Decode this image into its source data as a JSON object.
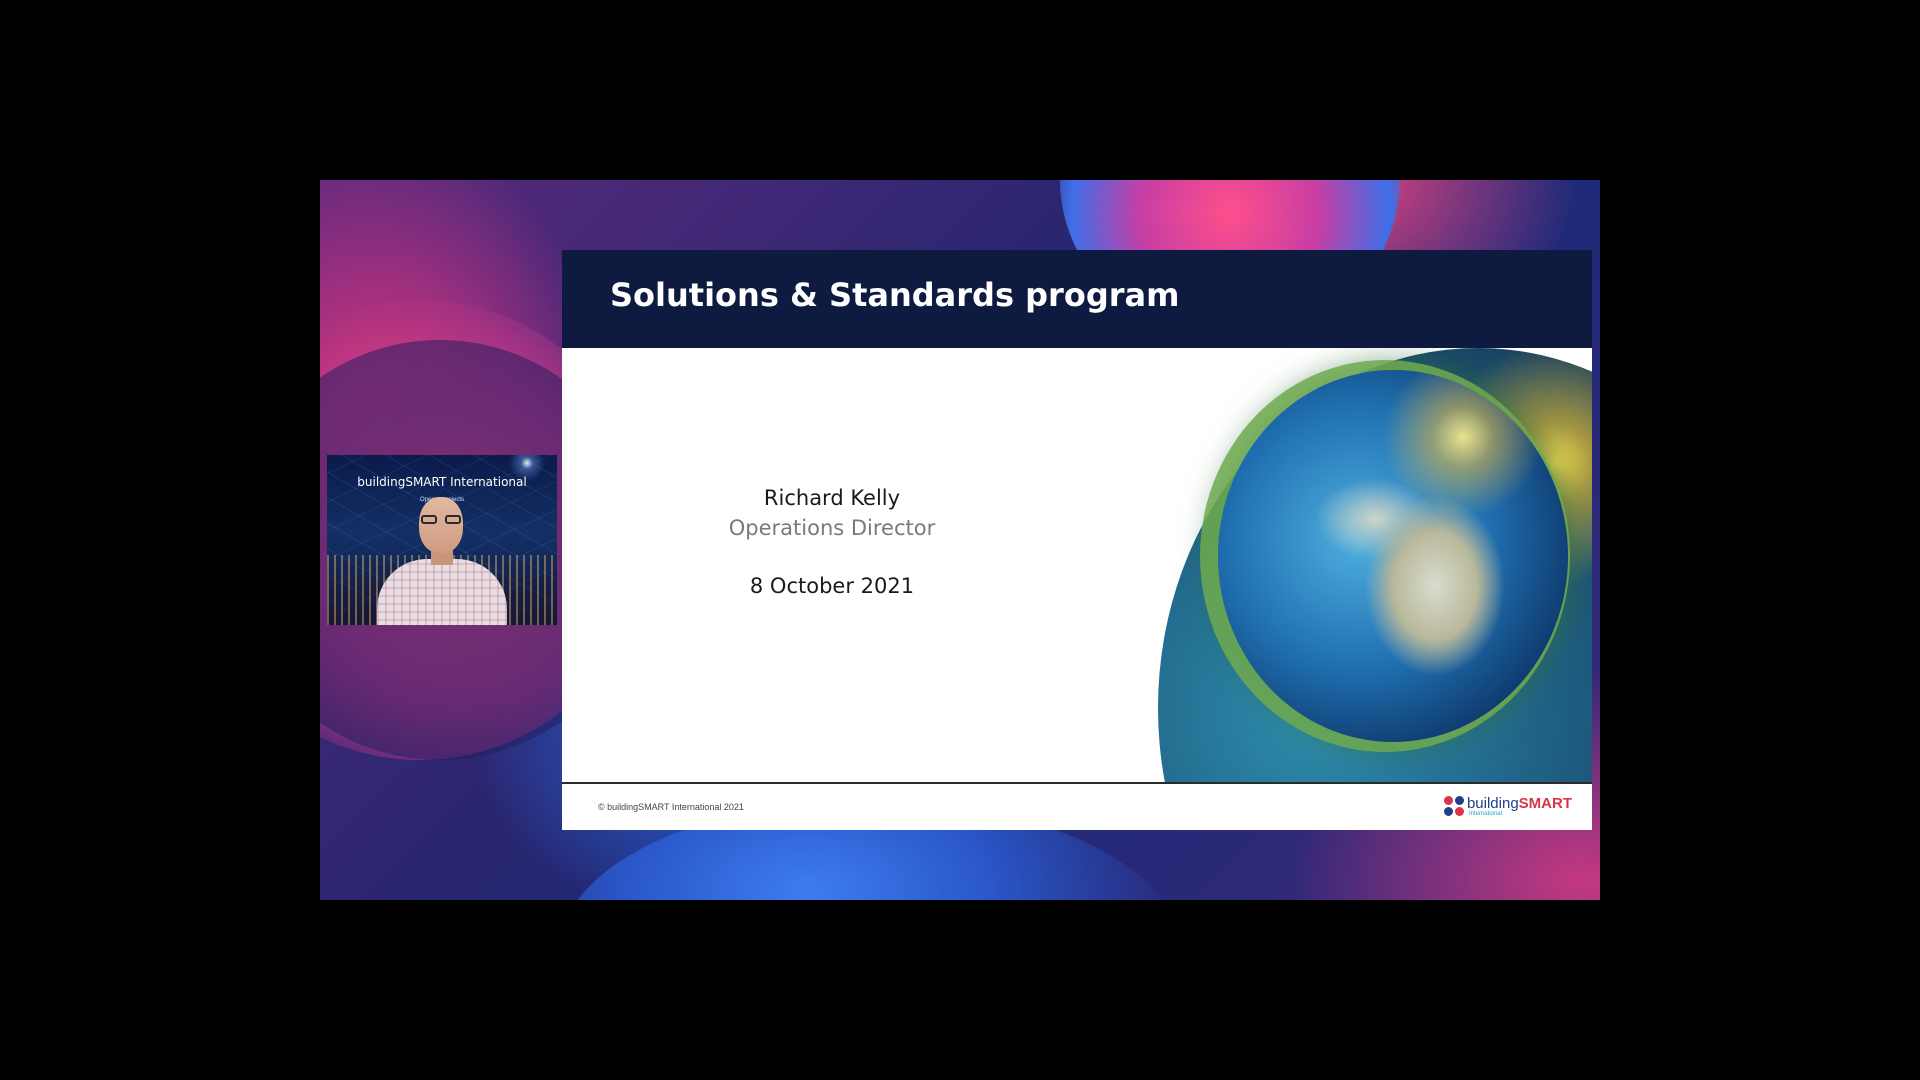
{
  "webcam": {
    "banner_title": "buildingSMART International",
    "banner_subtitle": "Open ... projects"
  },
  "slide": {
    "title": "Solutions & Standards program",
    "presenter_name": "Richard Kelly",
    "presenter_role": "Operations Director",
    "date": "8 October 2021",
    "footer_copyright": "© buildingSMART International 2021",
    "logo": {
      "name_part1": "building",
      "name_part2": "SMART",
      "tagline": "International"
    }
  },
  "colors": {
    "header_bg": "#0e1a3f",
    "logo_blue": "#1e3f8a",
    "logo_red": "#d8354a",
    "role_gray": "#7a7a7a"
  }
}
